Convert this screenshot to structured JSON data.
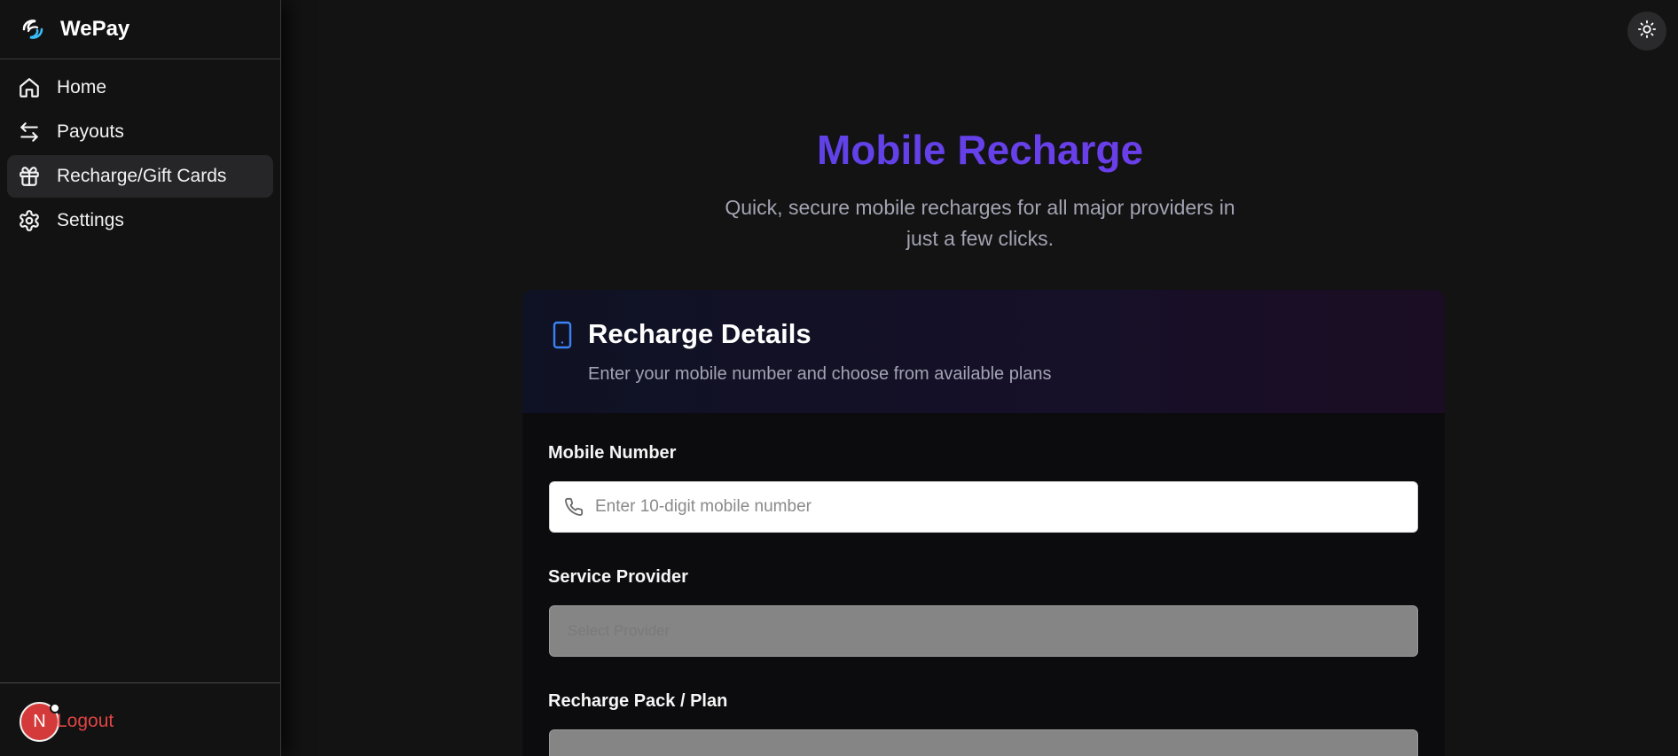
{
  "app": {
    "name": "WePay",
    "logo_icon": "wepay-logo-icon"
  },
  "sidebar": {
    "items": [
      {
        "label": "Home",
        "icon": "home-icon",
        "active": false
      },
      {
        "label": "Payouts",
        "icon": "arrows-left-right-icon",
        "active": false
      },
      {
        "label": "Recharge/Gift Cards",
        "icon": "gift-icon",
        "active": true
      },
      {
        "label": "Settings",
        "icon": "gear-icon",
        "active": false
      }
    ],
    "footer": {
      "avatar_initial": "N",
      "logout_label": "Logout"
    }
  },
  "header": {
    "theme_toggle_icon": "sun-icon"
  },
  "page": {
    "title": "Mobile Recharge",
    "subtitle": "Quick, secure mobile recharges for all major providers in just a few clicks."
  },
  "card": {
    "icon": "smartphone-icon",
    "title": "Recharge Details",
    "description": "Enter your mobile number and choose from available plans",
    "fields": {
      "mobile_number": {
        "label": "Mobile Number",
        "placeholder": "Enter 10-digit mobile number",
        "value": ""
      },
      "service_provider": {
        "label": "Service Provider",
        "placeholder": "Select Provider"
      },
      "plan": {
        "label": "Recharge Pack / Plan"
      }
    }
  },
  "colors": {
    "title_gradient_start": "#4f46e5",
    "title_gradient_end": "#7c3aed",
    "logout": "#e04444",
    "active_nav_bg": "#262628"
  }
}
